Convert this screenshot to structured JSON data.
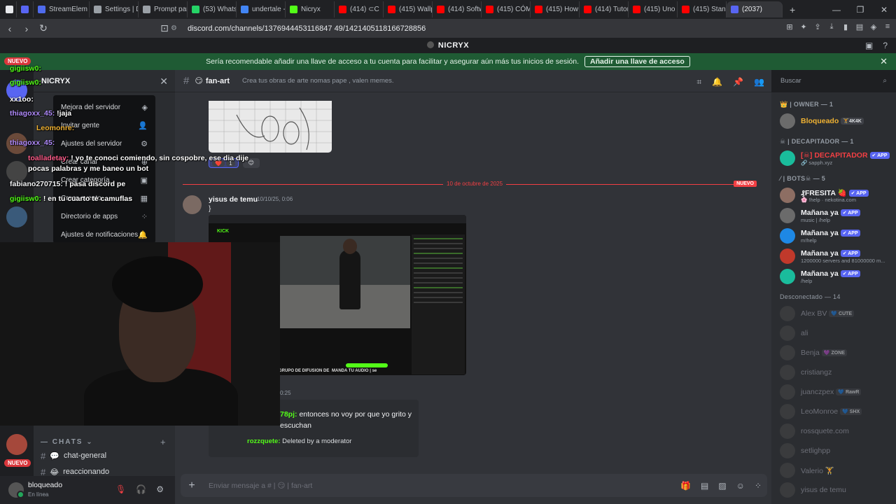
{
  "browser": {
    "tabs": [
      {
        "label": "",
        "color": "#e8eaed"
      },
      {
        "label": "",
        "color": "#5865f2"
      },
      {
        "label": "StreamElem",
        "color": "#4f6bed"
      },
      {
        "label": "Settings | D",
        "color": "#9aa0a6"
      },
      {
        "label": "Prompt par",
        "color": "#9aa0a6"
      },
      {
        "label": "(53) Whats",
        "color": "#25d366"
      },
      {
        "label": "undertale -",
        "color": "#4285f4"
      },
      {
        "label": "Nicryx",
        "color": "#53fc18"
      },
      {
        "label": "(414) ⊂C",
        "color": "#ff0000"
      },
      {
        "label": "(415) Wallp",
        "color": "#ff0000"
      },
      {
        "label": "(414) Softw",
        "color": "#ff0000"
      },
      {
        "label": "(415) CÓM",
        "color": "#ff0000"
      },
      {
        "label": "(415) How",
        "color": "#ff0000"
      },
      {
        "label": "(414) Tutor",
        "color": "#ff0000"
      },
      {
        "label": "(415) Uno",
        "color": "#ff0000"
      },
      {
        "label": "(415) Stan",
        "color": "#ff0000"
      },
      {
        "label": "(2037)",
        "color": "#5865f2",
        "active": true
      }
    ],
    "url": "discord.com/channels/1376944453116847 49/1421405118166728856"
  },
  "discord": {
    "window_title": "NICRYX",
    "banner_text": "Sería recomendable añadir una llave de acceso a tu cuenta para facilitar y asegurar aún más tus inicios de sesión.",
    "banner_button": "Añadir una llave de acceso",
    "server_name": "NICRYX",
    "server_menu": [
      {
        "label": "Mejora del servidor",
        "icon": "◈"
      },
      {
        "label": "Invitar gente",
        "icon": "👤"
      },
      {
        "label": "Ajustes del servidor",
        "icon": "⚙"
      },
      {
        "label": "Crear canal",
        "icon": "⊕"
      },
      {
        "label": "Crear categoría",
        "icon": "▣"
      },
      {
        "label": "Crear evento",
        "icon": "▦"
      },
      {
        "label": "Directorio de apps",
        "icon": "⁘"
      },
      {
        "label": "Ajustes de notificaciones",
        "icon": "🔔"
      }
    ],
    "category": "— CHATS ⌄",
    "channels": [
      {
        "emoji": "💬",
        "name": "chat-general"
      },
      {
        "emoji": "😂",
        "name": "reaccionando"
      }
    ],
    "user": {
      "name": "bloqueado",
      "status": "En línea"
    },
    "channel": {
      "emoji": "😏",
      "name": "fan-art",
      "topic": "Crea tus obras de arte nomas pape , valen memes."
    },
    "reactions": [
      {
        "emoji": "❤️",
        "count": "1"
      },
      {
        "emoji": "😊",
        "count": ""
      }
    ],
    "divider_date": "10 de octubre de 2025",
    "divider_badge": "NUEVO",
    "message": {
      "author": "yisus de temu",
      "time": "10/10/25, 0:06",
      "text": "}"
    },
    "screenshot_labels": {
      "kick": "KICK",
      "bottom": "GRUPO DE DIFUSION DE",
      "audio": "MANDA TU AUDIO | se",
      "time": "0:25"
    },
    "quoted_message": {
      "user": "78pj",
      "text": "entonces no voy por que yo grito y escuchan",
      "user2": "rozzquete",
      "text2": "Deleted by a moderator"
    },
    "input_placeholder": "Enviar mensaje a # | 😏 | fan-art",
    "search_placeholder": "Buscar",
    "member_groups": [
      {
        "label": "👑 | OWNER — 1",
        "members": [
          {
            "name": "Bloqueado",
            "tag": "🏋4K4K",
            "color": "#f0b232",
            "sub": ""
          }
        ]
      },
      {
        "label": "☠ | DECAPITADOR — 1",
        "members": [
          {
            "name": "[☠] DECAPITADOR",
            "tag": "✔ APP",
            "color": "#f23f43",
            "sub": "🔗 sapph.xyz"
          }
        ]
      },
      {
        "label": "⁄ | BOTS☠ — 5",
        "members": [
          {
            "name": "₰FRESITA 🍓",
            "tag": "✔ APP",
            "color": "#f2f3f5",
            "sub": "🌸 !help · nekotina.com"
          },
          {
            "name": "Mañana ya",
            "tag": "✔ APP",
            "color": "#f2f3f5",
            "sub": "music | /help"
          },
          {
            "name": "Mañana ya",
            "tag": "✔ APP",
            "color": "#f2f3f5",
            "sub": "m!help"
          },
          {
            "name": "Mañana ya",
            "tag": "✔ APP",
            "color": "#f2f3f5",
            "sub": "1200000 servers and 81000000 m..."
          },
          {
            "name": "Mañana ya",
            "tag": "✔ APP",
            "color": "#f2f3f5",
            "sub": "/help"
          }
        ]
      }
    ],
    "offline_label": "Desconectado — 14",
    "offline_members": [
      {
        "name": "Alex BV",
        "tag": "💙 CUTE"
      },
      {
        "name": "ali",
        "tag": ""
      },
      {
        "name": "Benja",
        "tag": "💜 ZONE"
      },
      {
        "name": "cristiangz",
        "tag": ""
      },
      {
        "name": "juanczpex",
        "tag": "💙 RawR"
      },
      {
        "name": "LeoMonroe",
        "tag": "💙 SHX"
      },
      {
        "name": "rossquete.com",
        "tag": ""
      },
      {
        "name": "setlighpp",
        "tag": ""
      },
      {
        "name": "Valerio 🏋",
        "tag": ""
      },
      {
        "name": "yisus de temu",
        "tag": ""
      }
    ]
  },
  "stream_overlay": {
    "nuevo": "NUEVO",
    "chat": [
      {
        "user": "gigiisw0:",
        "text": "",
        "color": "#53fc18"
      },
      {
        "user": "gigiisw0:",
        "text": "",
        "color": "#53fc18"
      },
      {
        "user": "xx1oo:",
        "text": "",
        "color": "#fff"
      },
      {
        "user": "thiagoxx_45:",
        "text": "!jaja",
        "color": "#b28cff"
      },
      {
        "user": "Leomonre:",
        "text": "",
        "color": "#f0b232"
      },
      {
        "user": "thiagoxx_45:",
        "text": "",
        "color": "#b28cff"
      },
      {
        "user": "toalladetay:",
        "text": "! yo te conoci comiendo, sin cospobre, ese dia dije pocas palabras y me baneo un bot",
        "color": "#ff5c8a"
      },
      {
        "user": "fabiano270715:",
        "text": "! pasa discord pe",
        "color": "#f2f3f5"
      },
      {
        "user": "gigiisw0:",
        "text": "! en tu cuarto te camuflas",
        "color": "#53fc18"
      }
    ]
  }
}
